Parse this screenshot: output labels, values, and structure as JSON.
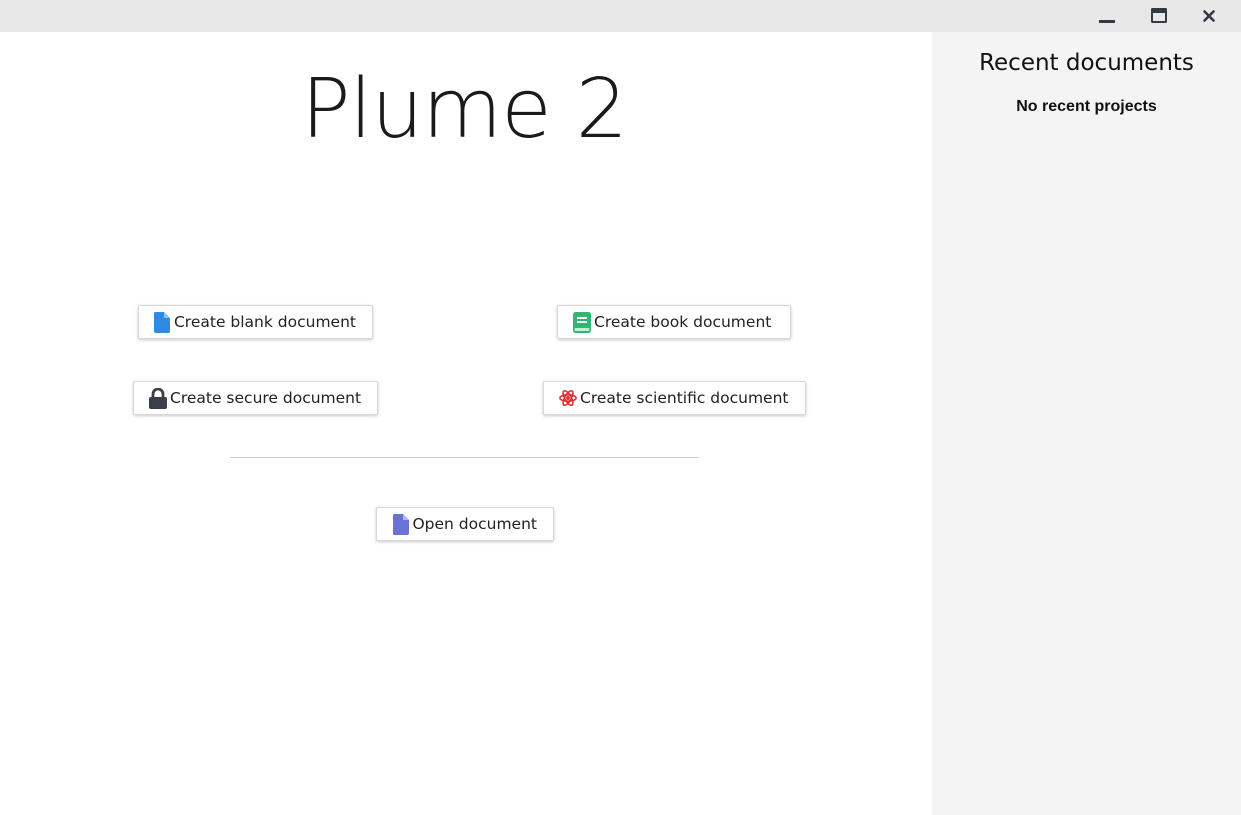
{
  "window": {
    "controls": {
      "minimize_icon": "minimize-icon",
      "maximize_icon": "maximize-icon",
      "close_icon": "close-icon"
    }
  },
  "main": {
    "app_title": "Plume 2",
    "buttons": {
      "blank": {
        "label": "Create blank document",
        "icon": "file-icon",
        "icon_color": "#2f8be0"
      },
      "book": {
        "label": "Create book document",
        "icon": "book-icon",
        "icon_color": "#2eb872"
      },
      "secure": {
        "label": "Create secure document",
        "icon": "lock-icon",
        "icon_color": "#3b4048"
      },
      "scientific": {
        "label": "Create scientific document",
        "icon": "atom-icon",
        "icon_color": "#e03131"
      },
      "open": {
        "label": "Open document",
        "icon": "file-icon",
        "icon_color": "#6b72d6"
      }
    }
  },
  "sidebar": {
    "title": "Recent documents",
    "empty_text": "No recent projects"
  }
}
